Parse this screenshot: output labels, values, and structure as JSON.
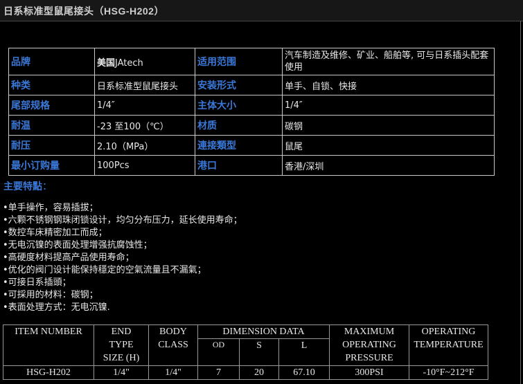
{
  "page": {
    "title": "日系标准型鼠尾接头（HSG-H202）"
  },
  "spec_table": {
    "rows": [
      {
        "l1": "品牌",
        "v1_bold": "美国",
        "v1": "JAtech",
        "l2": "适用范围",
        "v2": "汽车制造及维修、矿业、船舶等, 可与日系插头配套使用"
      },
      {
        "l1": "种类",
        "v1": "日系标准型鼠尾接头",
        "l2": "安装形式",
        "v2": "单手、自锁、快接"
      },
      {
        "l1": "尾部规格",
        "v1": "1/4″",
        "l2": "主体大小",
        "v2": "1/4″"
      },
      {
        "l1": "耐温",
        "v1": "-23 至100（℃）",
        "l2": "材质",
        "v2": "碳钢"
      },
      {
        "l1": "耐压",
        "v1": "2.10（MPa）",
        "l2": "連接類型",
        "v2": "鼠尾"
      },
      {
        "l1": "最小订购量",
        "v1": "100Pcs",
        "l2": "港口",
        "v2": "香港/深圳"
      }
    ]
  },
  "features": {
    "title": "主要特點",
    "colon": "：",
    "items": [
      "单手操作，容易插拔；",
      "六颗不锈钢钢珠闭锁设计，均匀分布压力，延长使用寿命；",
      "数控车床精密加工而成；",
      "无电沉镍的表面处理增强抗腐蚀性；",
      "高硬度材料提高产品使用寿命；",
      "优化的阀门设计能保持穩定的空氣流量且不漏氣；",
      "可接日系插頭；",
      "可採用的材料：碳钢；",
      "表面处理方式：无电沉镍."
    ]
  },
  "item_table": {
    "headers": {
      "item_number": "ITEM NUMBER",
      "end_type_size": [
        "END",
        "TYPE",
        "SIZE (H)"
      ],
      "body_class": [
        "BODY",
        "CLASS"
      ],
      "dimension_data": "DIMENSION DATA",
      "od": "OD",
      "s": "S",
      "l": "L",
      "max_pressure": [
        "MAXIMUM",
        "OPERATING",
        "PRESSURE"
      ],
      "operating_temperature": [
        "OPERATING",
        "TEMPERATURE"
      ]
    },
    "row": {
      "item_number": "HSG-H202",
      "end_type_size": "1/4\"",
      "body_class": "1/4\"",
      "od": "7",
      "s": "20",
      "l": "67.10",
      "max_pressure": "300PSI",
      "operating_temperature": "-10°F~212°F"
    }
  }
}
